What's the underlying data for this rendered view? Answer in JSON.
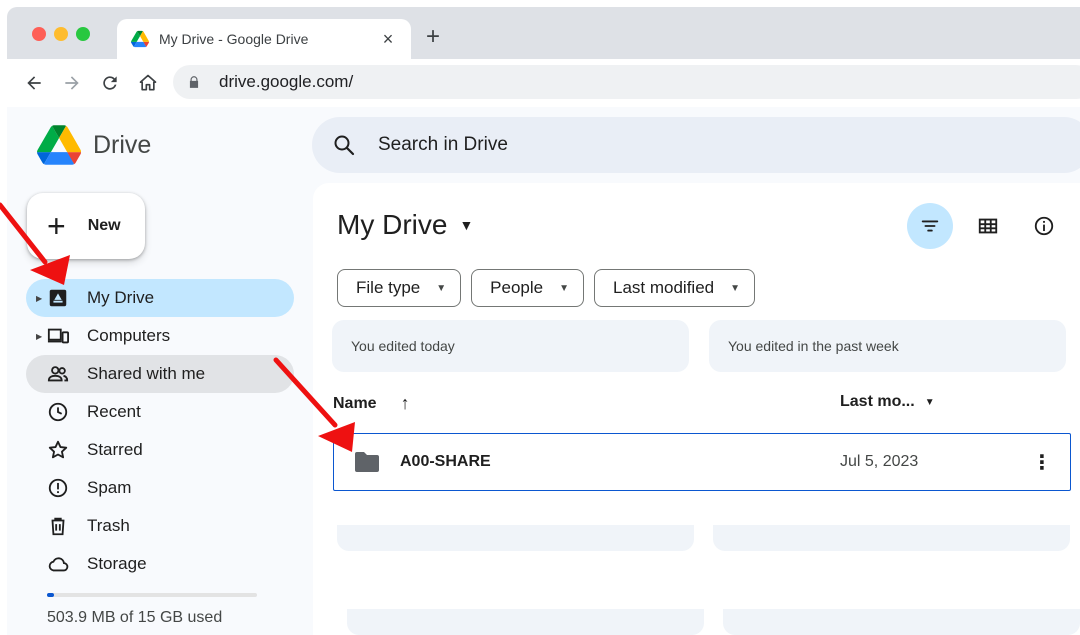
{
  "browser": {
    "tab_title": "My Drive - Google Drive",
    "tab_close": "×",
    "new_tab": "+",
    "url": "drive.google.com/"
  },
  "drive": {
    "product_name": "Drive",
    "search_placeholder": "Search in Drive",
    "new_button": "New",
    "new_plus": "+"
  },
  "sidebar": {
    "items": [
      {
        "label": "My Drive",
        "icon": "my-drive-icon",
        "active": true,
        "expandable": true
      },
      {
        "label": "Computers",
        "icon": "computers-icon",
        "active": false,
        "expandable": true
      },
      {
        "label": "Shared with me",
        "icon": "shared-icon",
        "active": false,
        "expandable": false
      },
      {
        "label": "Recent",
        "icon": "clock-icon",
        "active": false,
        "expandable": false
      },
      {
        "label": "Starred",
        "icon": "star-icon",
        "active": false,
        "expandable": false
      },
      {
        "label": "Spam",
        "icon": "spam-icon",
        "active": false,
        "expandable": false
      },
      {
        "label": "Trash",
        "icon": "trash-icon",
        "active": false,
        "expandable": false
      },
      {
        "label": "Storage",
        "icon": "cloud-icon",
        "active": false,
        "expandable": false
      }
    ],
    "storage_text": "503.9 MB of 15 GB used",
    "storage_fraction": 0.033
  },
  "main": {
    "title": "My Drive",
    "filters": [
      "File type",
      "People",
      "Last modified"
    ],
    "suggestions": [
      "You edited today",
      "You edited in the past week"
    ],
    "columns": {
      "name": "Name",
      "modified": "Last mo..."
    },
    "rows": [
      {
        "name": "A00-SHARE",
        "modified": "Jul 5, 2023",
        "type": "folder"
      }
    ]
  },
  "colors": {
    "accent": "#0b57d0",
    "active_bg": "#c2e7ff",
    "annotation": "#ff0000"
  }
}
